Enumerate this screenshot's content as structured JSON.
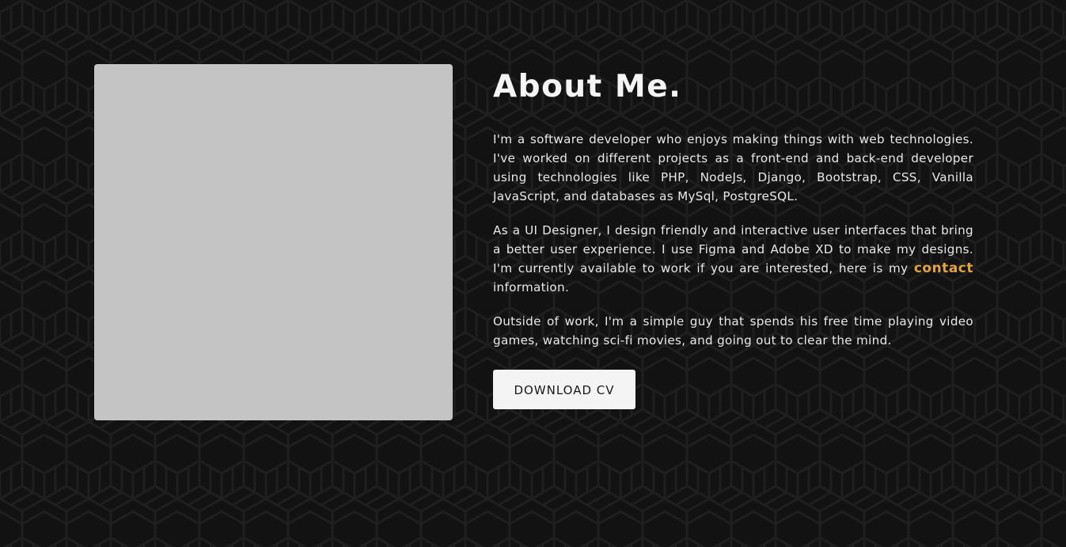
{
  "about": {
    "title": "About Me.",
    "paragraph1": "I'm a software developer who enjoys making things with web technologies. I've worked on different projects as a front-end and back-end developer using technologies like PHP, NodeJs, Django, Bootstrap, CSS, Vanilla JavaScript, and databases as MySql, PostgreSQL.",
    "paragraph2_before": "As a UI Designer, I design friendly and interactive user interfaces that bring a better user experience. I use Figma and Adobe XD to make my designs. I'm currently available to work if you are interested, here is my ",
    "contact_link": "contact",
    "paragraph2_after": " information.",
    "paragraph3": "Outside of work, I'm a simple guy that spends his free time playing video games, watching sci-fi movies, and going out to clear the mind.",
    "download_button": "DOWNLOAD CV"
  },
  "colors": {
    "background": "#121212",
    "accent": "#e3a33b",
    "photo_placeholder": "#c4c4c4",
    "button_bg": "#f4f4f4"
  }
}
